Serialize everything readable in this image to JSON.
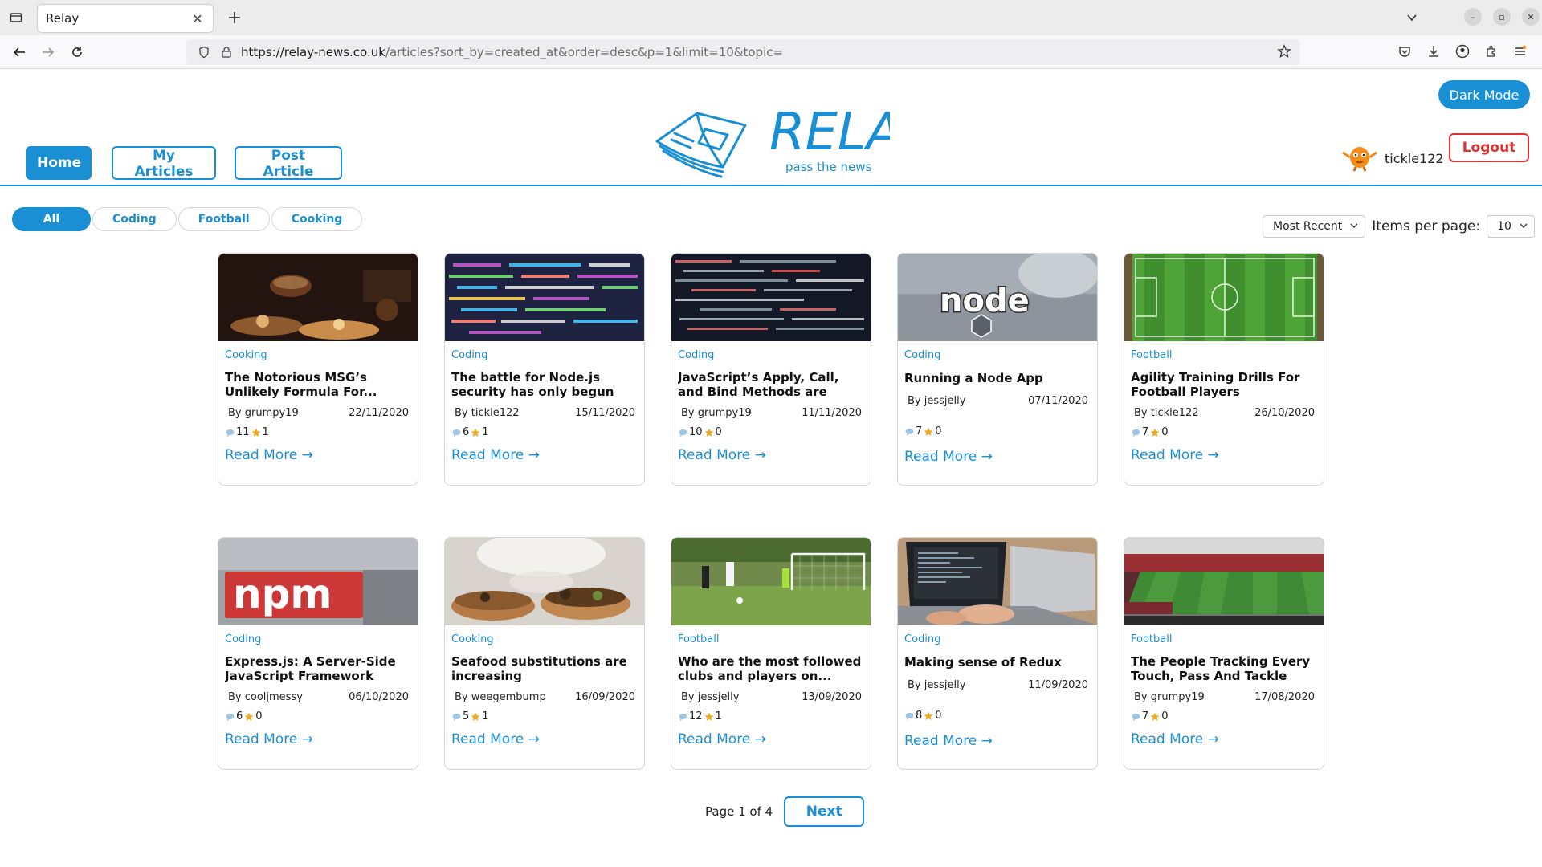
{
  "browser": {
    "tab_title": "Relay",
    "url_host": "https://relay-news.co.uk",
    "url_path": "/articles?sort_by=created_at&order=desc&p=1&limit=10&topic="
  },
  "header": {
    "nav": [
      "Home",
      "My Articles",
      "Post Article"
    ],
    "logo_text": "RELAY",
    "logo_tagline": "pass the news",
    "dark_mode_label": "Dark Mode",
    "username": "tickle122",
    "logout_label": "Logout"
  },
  "topics": [
    "All",
    "Coding",
    "Football",
    "Cooking"
  ],
  "sort": {
    "selected": "Most Recent",
    "items_per_page_label": "Items per page:",
    "items_per_page": "10"
  },
  "articles": [
    {
      "topic": "Cooking",
      "title": "The Notorious MSG’s Unlikely Formula For...",
      "author": "By grumpy19",
      "date": "22/11/2020",
      "comments": "11",
      "votes": "1",
      "link": "Read More →"
    },
    {
      "topic": "Coding",
      "title": "The battle for Node.js security has only begun",
      "author": "By tickle122",
      "date": "15/11/2020",
      "comments": "6",
      "votes": "1",
      "link": "Read More →"
    },
    {
      "topic": "Coding",
      "title": "JavaScript’s Apply, Call, and Bind Methods are Essentia...",
      "author": "By grumpy19",
      "date": "11/11/2020",
      "comments": "10",
      "votes": "0",
      "link": "Read More →"
    },
    {
      "topic": "Coding",
      "title": "Running a Node App",
      "author": "By jessjelly",
      "date": "07/11/2020",
      "comments": "7",
      "votes": "0",
      "link": "Read More →"
    },
    {
      "topic": "Football",
      "title": "Agility Training Drills For Football Players",
      "author": "By tickle122",
      "date": "26/10/2020",
      "comments": "7",
      "votes": "0",
      "link": "Read More →"
    },
    {
      "topic": "Coding",
      "title": "Express.js: A Server-Side JavaScript Framework",
      "author": "By cooljmessy",
      "date": "06/10/2020",
      "comments": "6",
      "votes": "0",
      "link": "Read More →"
    },
    {
      "topic": "Cooking",
      "title": "Seafood substitutions are increasing",
      "author": "By weegembump",
      "date": "16/09/2020",
      "comments": "5",
      "votes": "1",
      "link": "Read More →"
    },
    {
      "topic": "Football",
      "title": "Who are the most followed clubs and players on...",
      "author": "By jessjelly",
      "date": "13/09/2020",
      "comments": "12",
      "votes": "1",
      "link": "Read More →"
    },
    {
      "topic": "Coding",
      "title": "Making sense of Redux",
      "author": "By jessjelly",
      "date": "11/09/2020",
      "comments": "8",
      "votes": "0",
      "link": "Read More →"
    },
    {
      "topic": "Football",
      "title": "The People Tracking Every Touch, Pass And Tackle in...",
      "author": "By grumpy19",
      "date": "17/08/2020",
      "comments": "7",
      "votes": "0",
      "link": "Read More →"
    }
  ],
  "image_labels": {
    "npm": "npm",
    "node": "node"
  },
  "pager": {
    "text": "Page 1 of 4",
    "next_label": "Next"
  },
  "colors": {
    "accent": "#1b8fd4",
    "danger": "#e03131",
    "star": "#f2a71b"
  }
}
